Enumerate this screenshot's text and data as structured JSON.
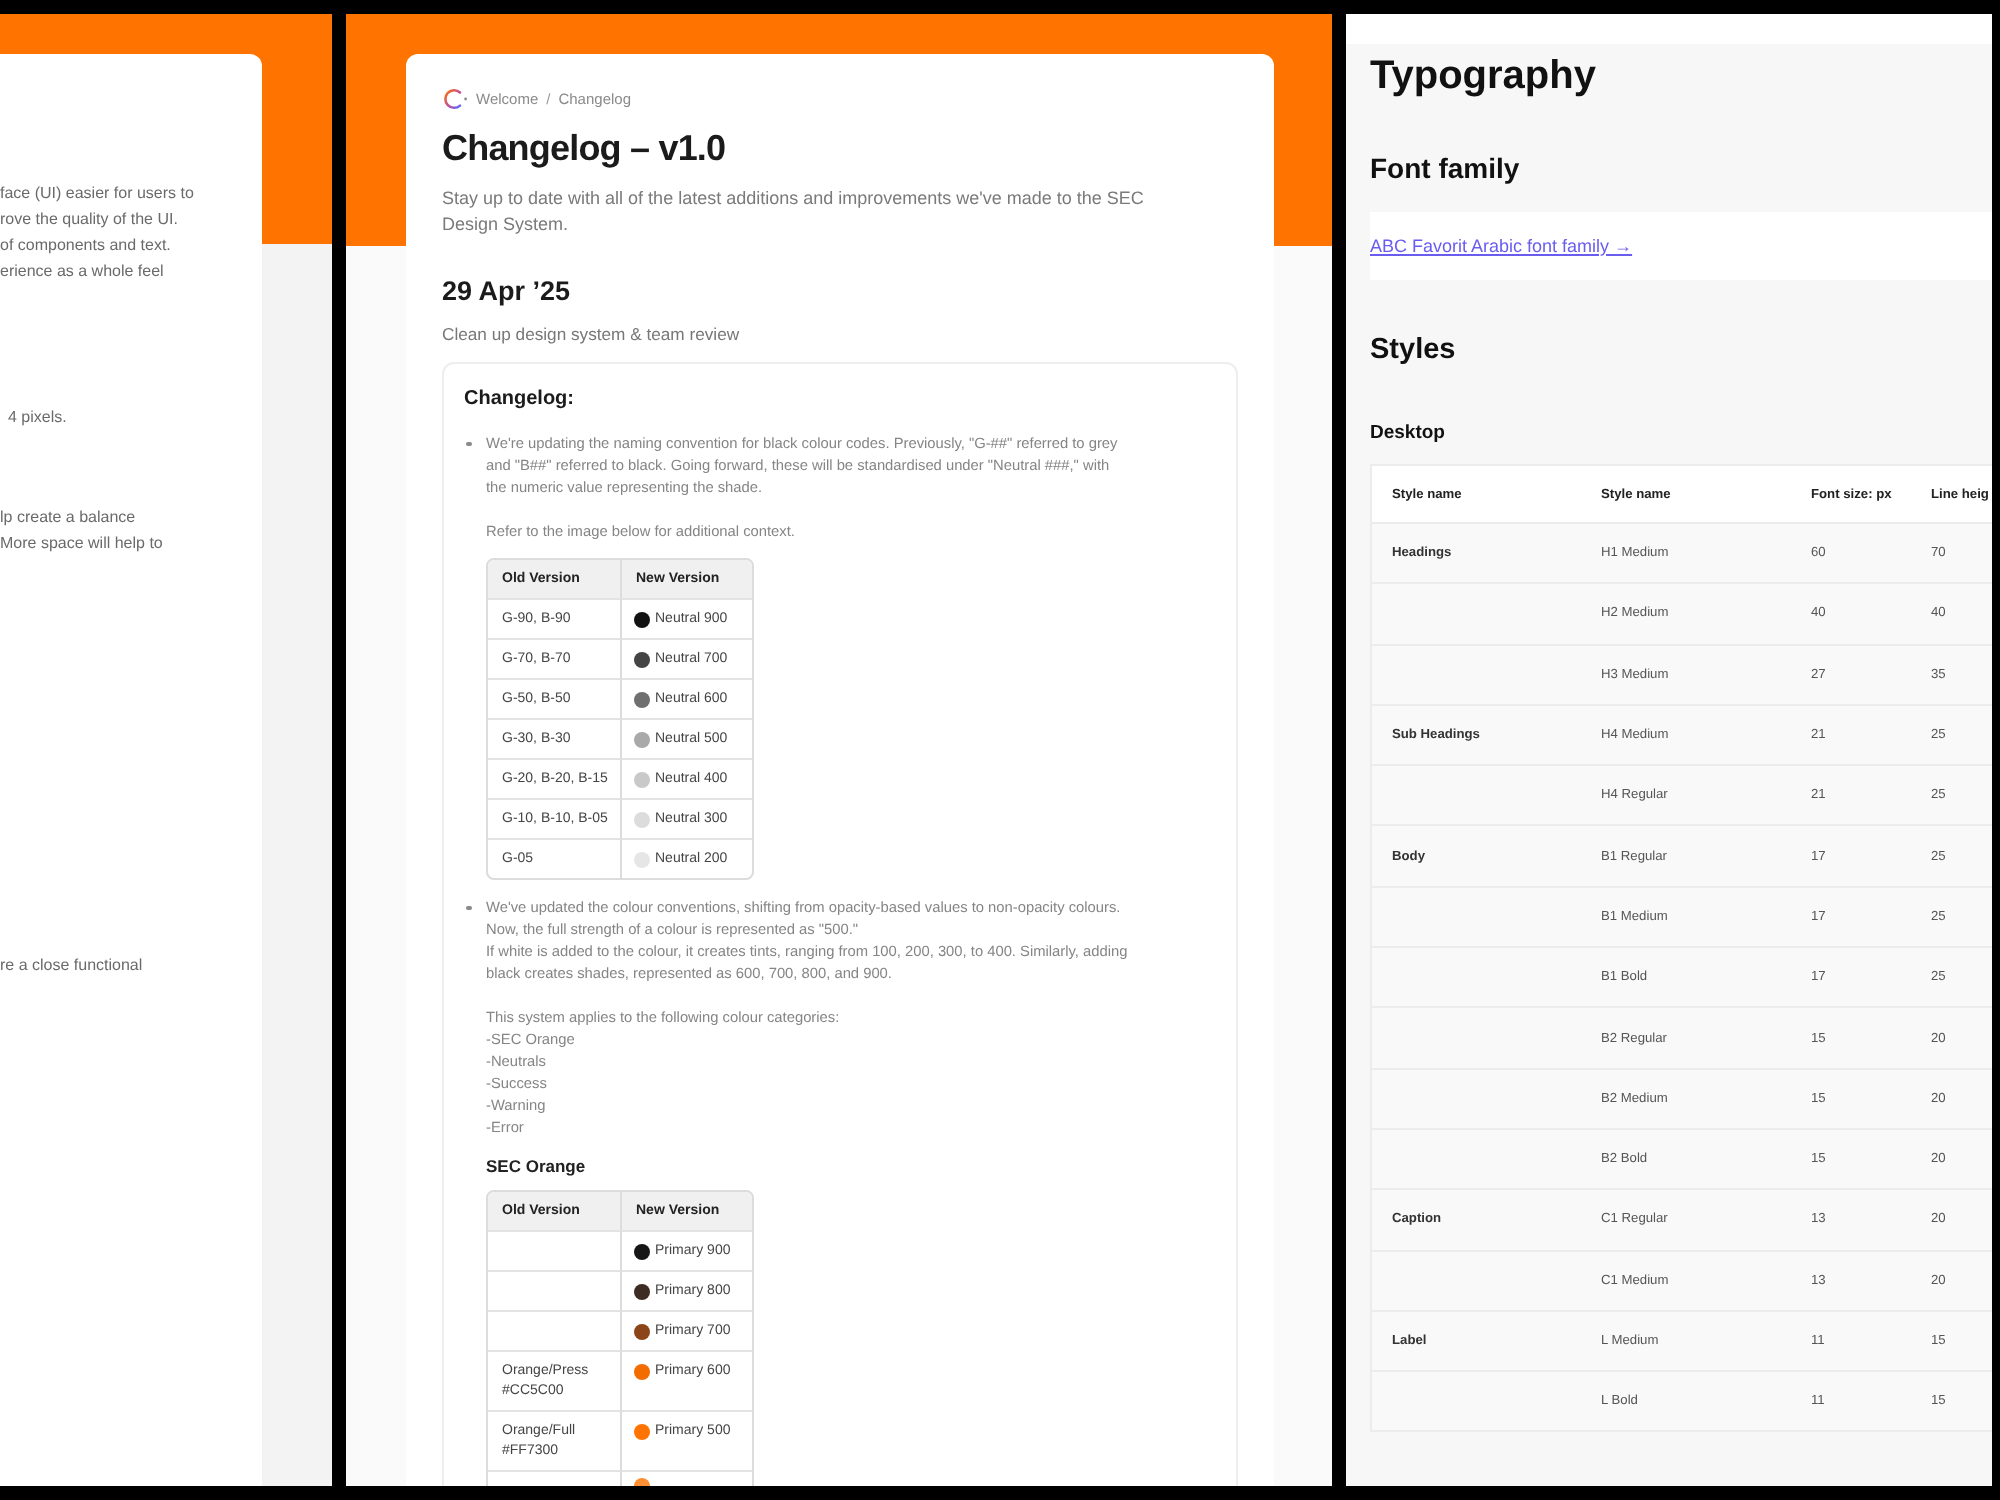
{
  "left_panel": {
    "paragraphs": [
      "face (UI) easier for users to\nrove the quality of the UI.\nof components and text.\nerience as a whole feel",
      "4 pixels.",
      "lp create a balance\nMore space will help to",
      "re a close functional"
    ]
  },
  "changelog_page": {
    "breadcrumb": [
      "Welcome",
      "Changelog"
    ],
    "breadcrumb_separator": "/",
    "title": "Changelog – v1.0",
    "subtitle": "Stay up to date with all of the latest additions and improvements we've made to the SEC Design System.",
    "date": "29 Apr ’25",
    "summary": "Clean up design system & team review",
    "changelog_box": {
      "heading": "Changelog:",
      "items": [
        {
          "text": "We're updating the naming convention for black colour codes. Previously, \"G-##\" referred to grey\nand \"B##\" referred to black. Going forward, these will be standardised under \"Neutral ###,\" with\nthe numeric value representing the shade.",
          "note": "Refer to the image below for additional context.",
          "tables": [
            {
              "columns": [
                "Old Version",
                "New Version"
              ],
              "rows": [
                {
                  "old": "G-90, B-90",
                  "new": "Neutral 900",
                  "color": "#121212"
                },
                {
                  "old": "G-70, B-70",
                  "new": "Neutral 700",
                  "color": "#444444"
                },
                {
                  "old": "G-50, B-50",
                  "new": "Neutral 600",
                  "color": "#6f6f6f"
                },
                {
                  "old": "G-30, B-30",
                  "new": "Neutral 500",
                  "color": "#a9a9a9"
                },
                {
                  "old": "G-20, B-20, B-15",
                  "new": "Neutral 400",
                  "color": "#c9c9c9"
                },
                {
                  "old": "G-10, B-10, B-05",
                  "new": "Neutral 300",
                  "color": "#dcdcdc"
                },
                {
                  "old": "G-05",
                  "new": "Neutral 200",
                  "color": "#e6e6e6"
                }
              ]
            }
          ]
        },
        {
          "text": "We've updated the colour conventions, shifting from opacity-based values to non-opacity colours.\nNow, the full strength of a colour is represented as \"500.\"\nIf white is added to the colour, it creates tints, ranging from 100, 200, 300, to 400. Similarly, adding\nblack creates shades, represented as 600, 700, 800, and 900.",
          "note": "This system applies to the following colour categories:\n-SEC Orange\n-Neutrals\n-Success\n-Warning\n-Error",
          "tables": [
            {
              "title": "SEC Orange",
              "columns": [
                "Old Version",
                "New Version"
              ],
              "rows": [
                {
                  "new": "Primary 900",
                  "color": "#161616"
                },
                {
                  "new": "Primary 800",
                  "color": "#3d2c24"
                },
                {
                  "new": "Primary 700",
                  "color": "#8c4518"
                },
                {
                  "old": "Orange/Press\n#CC5C00",
                  "new": "Primary 600",
                  "color": "#f26c00"
                },
                {
                  "old": "Orange/Full\n#FF7300",
                  "new": "Primary 500",
                  "color": "#ff7300"
                },
                {
                  "color": "#ff8f33"
                }
              ]
            }
          ]
        }
      ]
    }
  },
  "typography_page": {
    "title": "Typography",
    "font_family": {
      "heading": "Font family",
      "link": "ABC Favorit Arabic font family →"
    },
    "styles": {
      "heading": "Styles",
      "subheading": "Desktop",
      "table": {
        "columns": [
          "Style name",
          "Style name",
          "Font size: px",
          "Line heig"
        ],
        "rows": [
          [
            "Headings",
            "H1 Medium",
            "60",
            "70"
          ],
          [
            null,
            "H2 Medium",
            "40",
            "40"
          ],
          [
            null,
            "H3 Medium",
            "27",
            "35"
          ],
          [
            "Sub Headings",
            "H4 Medium",
            "21",
            "25"
          ],
          [
            null,
            "H4 Regular",
            "21",
            "25"
          ],
          [
            "Body",
            "B1 Regular",
            "17",
            "25"
          ],
          [
            null,
            "B1 Medium",
            "17",
            "25"
          ],
          [
            null,
            "B1 Bold",
            "17",
            "25"
          ],
          [
            null,
            "B2 Regular",
            "15",
            "20"
          ],
          [
            null,
            "B2 Medium",
            "15",
            "20"
          ],
          [
            null,
            "B2 Bold",
            "15",
            "20"
          ],
          [
            "Caption",
            "C1 Regular",
            "13",
            "20"
          ],
          [
            null,
            "C1 Medium",
            "13",
            "20"
          ],
          [
            "Label",
            "L Medium",
            "11",
            "15"
          ],
          [
            null,
            "L Bold",
            "11",
            "15"
          ]
        ]
      }
    }
  }
}
